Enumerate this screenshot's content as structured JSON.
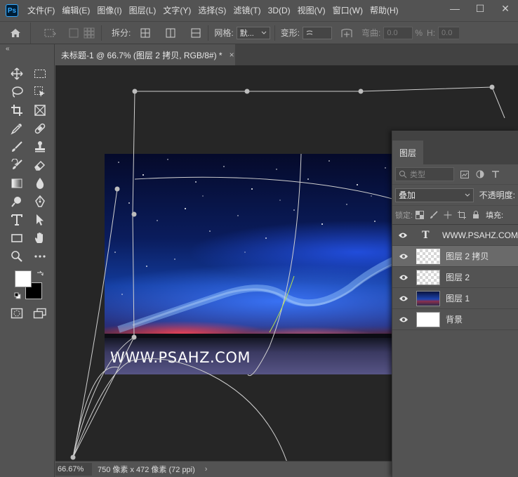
{
  "app": {
    "logo": "Ps",
    "window_controls": [
      "—",
      "☐",
      "✕"
    ]
  },
  "menu": [
    "文件(F)",
    "编辑(E)",
    "图像(I)",
    "图层(L)",
    "文字(Y)",
    "选择(S)",
    "滤镜(T)",
    "3D(D)",
    "视图(V)",
    "窗口(W)",
    "帮助(H)"
  ],
  "options": {
    "split_label": "拆分:",
    "mesh_label": "网格:",
    "mesh_value": "默...",
    "warp_label": "变形:",
    "bend_label": "弯曲:",
    "bend_value": "0.0",
    "percent": "%",
    "h_label": "H:",
    "h_value": "0.0"
  },
  "document": {
    "tab_title": "未标题-1 @ 66.7% (图层 2 拷贝, RGB/8#) *",
    "close": "×"
  },
  "canvas": {
    "watermark": "WWW.PSAHZ.COM"
  },
  "status": {
    "zoom": "66.67%",
    "doc_info": "750 像素 x 472 像素 (72 ppi)",
    "arrow": "›"
  },
  "toolbar": {
    "collapse": "«"
  },
  "layers_panel": {
    "tab_label": "图层",
    "filter_kind": "类型",
    "blend_mode": "叠加",
    "opacity_label": "不透明度:",
    "lock_label": "锁定:",
    "fill_label": "填充:",
    "layers": [
      {
        "name": "WWW.PSAHZ.COM",
        "thumb": "text",
        "thumb_glyph": "T",
        "selected": false
      },
      {
        "name": "图层 2 拷贝",
        "thumb": "checker",
        "selected": true
      },
      {
        "name": "图层 2",
        "thumb": "checker",
        "selected": false
      },
      {
        "name": "图层 1",
        "thumb": "photo",
        "selected": false
      },
      {
        "name": "背景",
        "thumb": "white",
        "selected": false
      }
    ]
  },
  "colors": {
    "ui_bg": "#535353",
    "canvas_bg": "#262626",
    "accent": "#31a8ff"
  }
}
